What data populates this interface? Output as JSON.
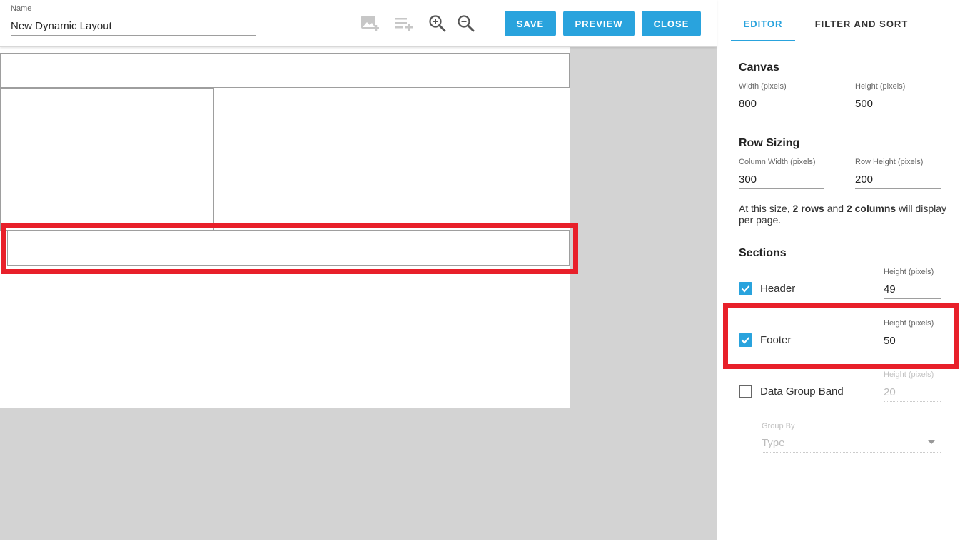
{
  "header": {
    "name_label": "Name",
    "name_value": "New Dynamic Layout",
    "icons": [
      "add-image-icon",
      "add-row-icon",
      "zoom-in-icon",
      "zoom-out-icon"
    ],
    "buttons": {
      "save": "SAVE",
      "preview": "PREVIEW",
      "close": "CLOSE"
    }
  },
  "tabs": {
    "editor": "EDITOR",
    "filter_sort": "FILTER AND SORT"
  },
  "canvas": {
    "title": "Canvas",
    "width_label": "Width (pixels)",
    "width_value": "800",
    "height_label": "Height (pixels)",
    "height_value": "500"
  },
  "row_sizing": {
    "title": "Row Sizing",
    "col_width_label": "Column Width (pixels)",
    "col_width_value": "300",
    "row_height_label": "Row Height (pixels)",
    "row_height_value": "200",
    "info_prefix": "At this size, ",
    "info_rows": "2 rows",
    "info_mid": " and ",
    "info_cols": "2 columns",
    "info_suffix": " will display per page."
  },
  "sections": {
    "title": "Sections",
    "header": {
      "label": "Header",
      "checked": true,
      "height_label": "Height (pixels)",
      "height_value": "49"
    },
    "footer": {
      "label": "Footer",
      "checked": true,
      "height_label": "Height (pixels)",
      "height_value": "50"
    },
    "data_group_band": {
      "label": "Data Group Band",
      "checked": false,
      "height_label": "Height (pixels)",
      "height_value": "20"
    },
    "group_by": {
      "label": "Group By",
      "value": "Type"
    }
  },
  "colors": {
    "accent": "#29a3dd",
    "highlight": "#e8202a",
    "canvas_bg": "#d3d3d3"
  }
}
